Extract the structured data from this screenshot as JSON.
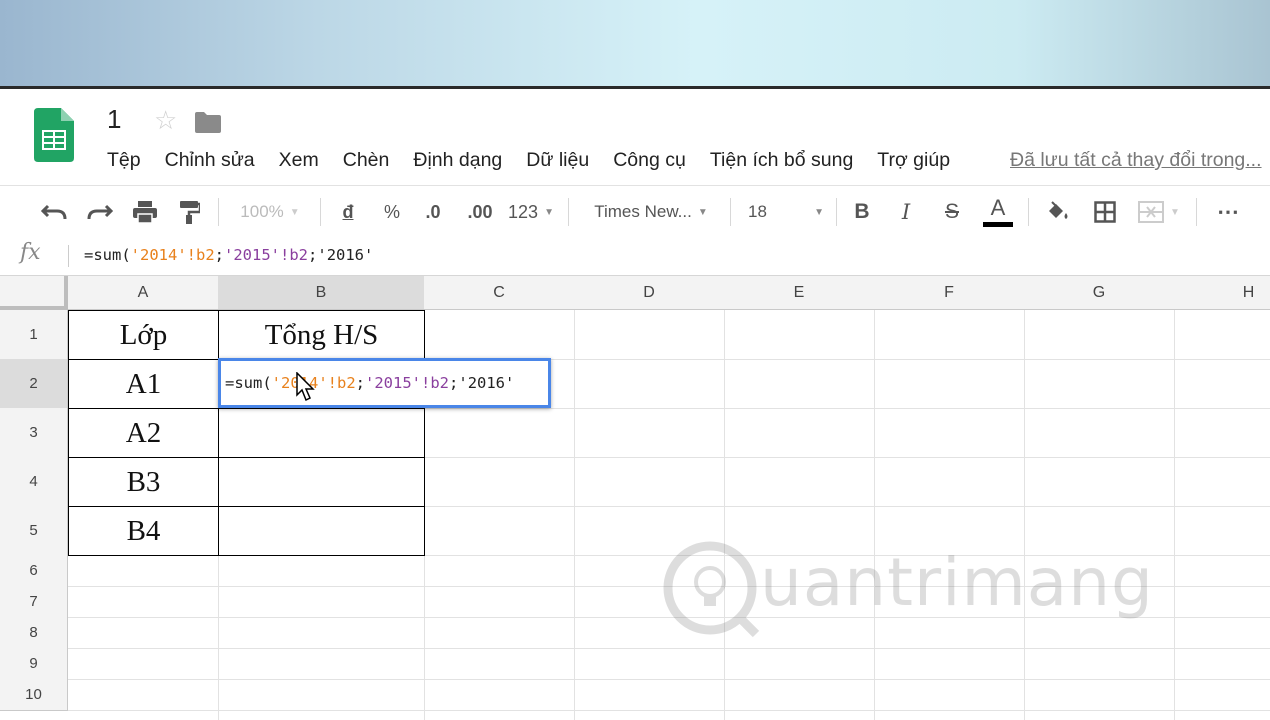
{
  "app": {
    "doc_title": "1",
    "save_status": "Đã lưu tất cả thay đổi trong..."
  },
  "menu": [
    "Tệp",
    "Chỉnh sửa",
    "Xem",
    "Chèn",
    "Định dạng",
    "Dữ liệu",
    "Công cụ",
    "Tiện ích bổ sung",
    "Trợ giúp"
  ],
  "toolbar": {
    "zoom": "100%",
    "currency": "đ",
    "percent": "%",
    "decrease_decimals": ".0",
    "increase_decimals": ".00",
    "more_formats": "123",
    "font_name": "Times New...",
    "font_size": "18",
    "bold": "B",
    "italic": "I",
    "strikethrough": "S",
    "text_color_label": "A",
    "more": "⋯",
    "colors": {
      "text_color_bar": "#000000",
      "accent": "#4a86e8"
    }
  },
  "formula_bar": {
    "fx_label": "fx",
    "parts": [
      "=sum(",
      "'2014'!b2",
      ";",
      "'2015'!b2",
      ";",
      "'2016'"
    ]
  },
  "columns": [
    "A",
    "B",
    "C",
    "D",
    "E",
    "F",
    "G",
    "H"
  ],
  "rows": [
    "1",
    "2",
    "3",
    "4",
    "5",
    "6",
    "7",
    "8",
    "9",
    "10"
  ],
  "cells": {
    "A1": "Lớp",
    "B1": "Tổng H/S",
    "A2": "A1",
    "A3": "A2",
    "A4": "B3",
    "A5": "B4"
  },
  "editor": {
    "cell": "B2",
    "parts": [
      "=sum(",
      "'2014'!b2",
      ";",
      "'2015'!b2",
      ";",
      "'2016'"
    ]
  },
  "watermark": {
    "text": "uantrimang"
  }
}
